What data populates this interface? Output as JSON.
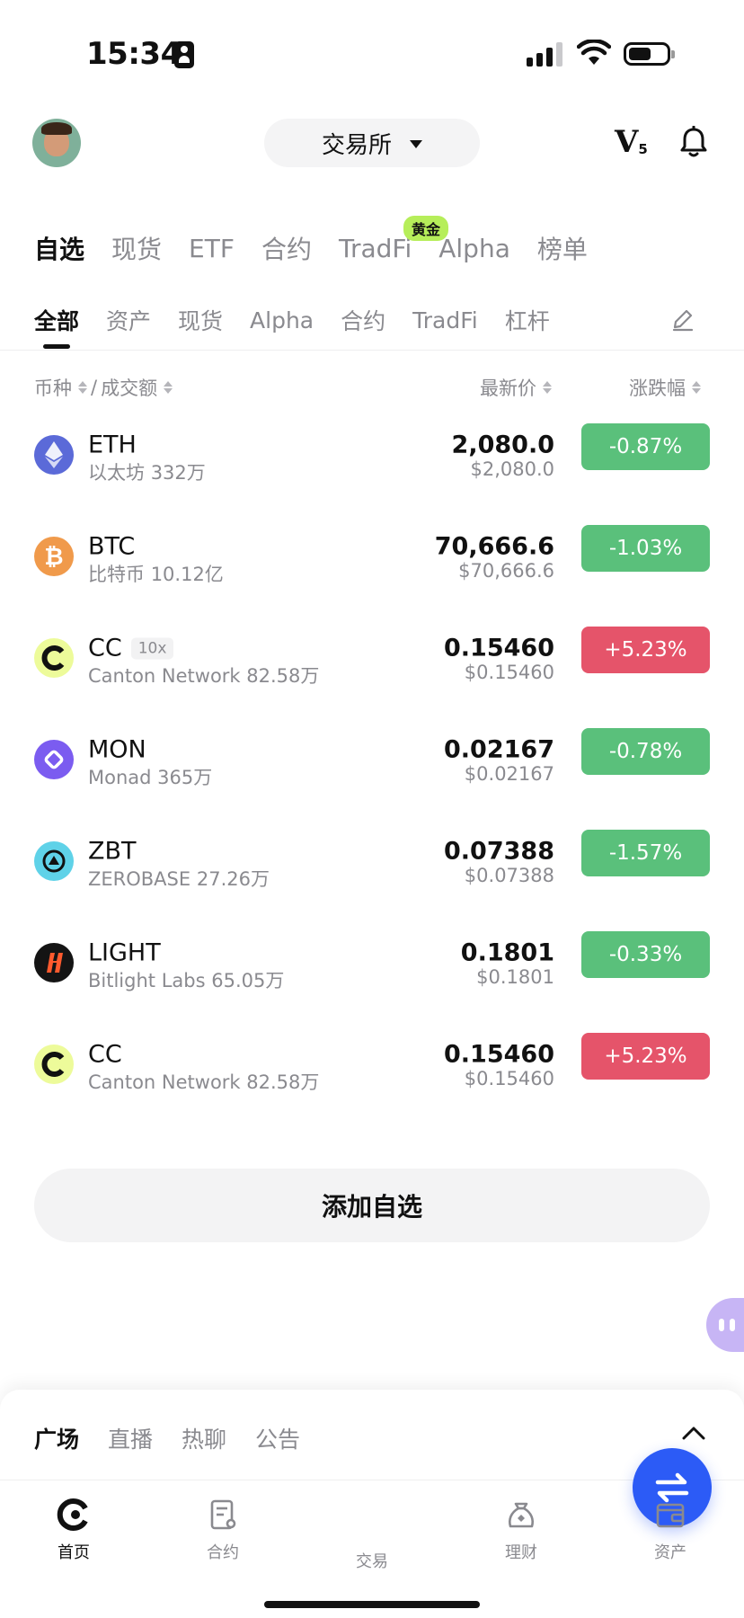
{
  "status_bar": {
    "time": "15:34"
  },
  "header": {
    "exchange_label": "交易所",
    "vip_letter": "V",
    "vip_level": "5"
  },
  "primary_tabs": [
    {
      "label": "自选",
      "active": true
    },
    {
      "label": "现货"
    },
    {
      "label": "ETF"
    },
    {
      "label": "合约"
    },
    {
      "label": "TradFi",
      "badge": "黄金"
    },
    {
      "label": "Alpha"
    },
    {
      "label": "榜单"
    }
  ],
  "secondary_tabs": [
    {
      "label": "全部",
      "active": true
    },
    {
      "label": "资产"
    },
    {
      "label": "现货"
    },
    {
      "label": "Alpha"
    },
    {
      "label": "合约"
    },
    {
      "label": "TradFi"
    },
    {
      "label": "杠杆"
    }
  ],
  "columns": {
    "coin": "币种",
    "separator": "/",
    "volume": "成交额",
    "price": "最新价",
    "change": "涨跌幅"
  },
  "colors": {
    "up": "#e5546a",
    "down": "#5ac07b",
    "accent": "#2c5bf6"
  },
  "watchlist": [
    {
      "symbol": "ETH",
      "name": "以太坊",
      "volume": "332万",
      "price": "2,080.0",
      "usd": "$2,080.0",
      "change": "-0.87%",
      "direction": "down",
      "icon": "ethereum-icon"
    },
    {
      "symbol": "BTC",
      "name": "比特币",
      "volume": "10.12亿",
      "price": "70,666.6",
      "usd": "$70,666.6",
      "change": "-1.03%",
      "direction": "down",
      "icon": "bitcoin-icon"
    },
    {
      "symbol": "CC",
      "leverage": "10x",
      "name": "Canton Network",
      "volume": "82.58万",
      "price": "0.15460",
      "usd": "$0.15460",
      "change": "+5.23%",
      "direction": "up",
      "icon": "canton-icon"
    },
    {
      "symbol": "MON",
      "name": "Monad",
      "volume": "365万",
      "price": "0.02167",
      "usd": "$0.02167",
      "change": "-0.78%",
      "direction": "down",
      "icon": "monad-icon"
    },
    {
      "symbol": "ZBT",
      "name": "ZEROBASE",
      "volume": "27.26万",
      "price": "0.07388",
      "usd": "$0.07388",
      "change": "-1.57%",
      "direction": "down",
      "icon": "zerobase-icon"
    },
    {
      "symbol": "LIGHT",
      "name": "Bitlight Labs",
      "volume": "65.05万",
      "price": "0.1801",
      "usd": "$0.1801",
      "change": "-0.33%",
      "direction": "down",
      "icon": "bitlight-icon"
    },
    {
      "symbol": "CC",
      "name": "Canton Network",
      "volume": "82.58万",
      "price": "0.15460",
      "usd": "$0.15460",
      "change": "+5.23%",
      "direction": "up",
      "icon": "canton-icon"
    }
  ],
  "add_button": "添加自选",
  "community_tabs": [
    {
      "label": "广场",
      "active": true
    },
    {
      "label": "直播"
    },
    {
      "label": "热聊"
    },
    {
      "label": "公告"
    }
  ],
  "bottom_nav": [
    {
      "label": "首页",
      "icon": "home-icon",
      "active": true
    },
    {
      "label": "合约",
      "icon": "futures-icon"
    },
    {
      "label": "交易",
      "icon": "trade-swap-icon"
    },
    {
      "label": "理财",
      "icon": "earn-icon"
    },
    {
      "label": "资产",
      "icon": "wallet-icon"
    }
  ]
}
